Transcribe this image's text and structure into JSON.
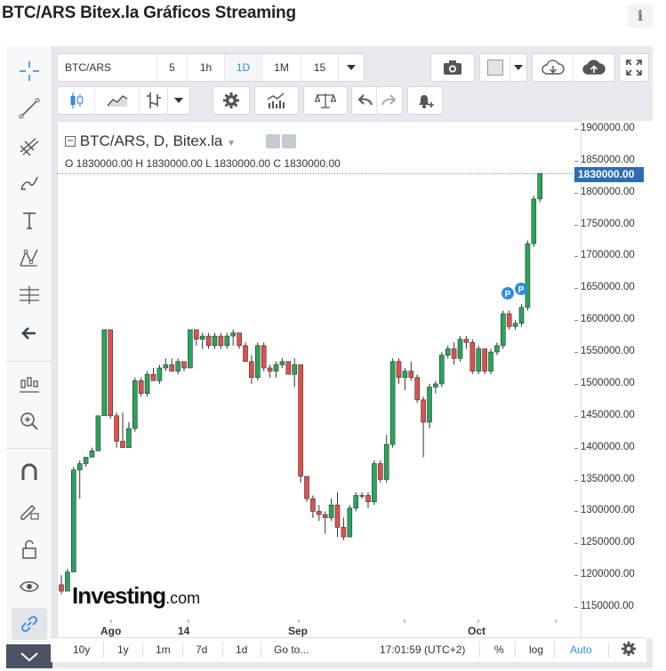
{
  "page": {
    "title": "BTC/ARS Bitex.la Gráficos Streaming",
    "info_icon": "i"
  },
  "toolbar": {
    "symbol": "BTC/ARS",
    "intervals": [
      "5",
      "1h",
      "1D",
      "1M",
      "15"
    ],
    "selected_interval": "1D",
    "row2_icons": [
      "candles-icon",
      "area-chart-icon",
      "bars-icon",
      "settings-icon",
      "indicators-icon",
      "compare-icon",
      "undo-icon",
      "redo-icon",
      "alert-icon"
    ],
    "right_icons": [
      "camera-icon",
      "color-square-icon",
      "cloud-download-icon",
      "cloud-upload-icon",
      "fullscreen-icon"
    ]
  },
  "left_tools": [
    "crosshair-icon",
    "trend-line-icon",
    "pitchfork-icon",
    "brush-icon",
    "text-icon",
    "pattern-icon",
    "measure-icon",
    "back-arrow-icon",
    "candle-zoom-icon",
    "zoom-in-icon",
    "magnet-icon",
    "lock-pencil-icon",
    "unlock-icon",
    "eye-icon",
    "link-icon"
  ],
  "legend": {
    "title": "BTC/ARS, D, Bitex.la",
    "ohlc": "O 1830000.00  H 1830000.00  L 1830000.00  C 1830000.00"
  },
  "price_axis": {
    "labels": [
      "1900000.00",
      "1850000.00",
      "1800000.00",
      "1750000.00",
      "1700000.00",
      "1650000.00",
      "1600000.00",
      "1550000.00",
      "1500000.00",
      "1450000.00",
      "1400000.00",
      "1350000.00",
      "1300000.00",
      "1250000.00",
      "1200000.00",
      "1150000.00"
    ],
    "last_price": "1830000.00"
  },
  "time_axis": {
    "labels": [
      "Ago",
      "14",
      "Sep",
      "Oct"
    ]
  },
  "bottom_bar": {
    "ranges": [
      "10y",
      "1y",
      "1m",
      "7d",
      "1d"
    ],
    "goto": "Go to...",
    "time": "17:01:59 (UTC+2)",
    "percent": "%",
    "log": "log",
    "auto": "Auto"
  },
  "watermark": {
    "brand": "Investing",
    "suffix": ".com"
  },
  "colors": {
    "up": "#26a65b",
    "down": "#e0514d",
    "accent": "#2f8de4",
    "last_price_bg": "#2d6db0"
  },
  "chart_data": {
    "type": "candlestick",
    "ylim": [
      1130000,
      1910000
    ],
    "yticks": [
      1150000,
      1200000,
      1250000,
      1300000,
      1350000,
      1400000,
      1450000,
      1500000,
      1550000,
      1600000,
      1650000,
      1700000,
      1750000,
      1800000,
      1850000,
      1900000
    ],
    "last_value": 1830000,
    "candles": [
      [
        1185000,
        1200000,
        1170000,
        1175000
      ],
      [
        1175000,
        1210000,
        1175000,
        1205000
      ],
      [
        1205000,
        1370000,
        1205000,
        1365000
      ],
      [
        1365000,
        1380000,
        1320000,
        1375000
      ],
      [
        1375000,
        1385000,
        1370000,
        1385000
      ],
      [
        1385000,
        1400000,
        1385000,
        1395000
      ],
      [
        1395000,
        1450000,
        1395000,
        1450000
      ],
      [
        1450000,
        1585000,
        1450000,
        1585000
      ],
      [
        1585000,
        1585000,
        1445000,
        1450000
      ],
      [
        1450000,
        1455000,
        1400000,
        1410000
      ],
      [
        1410000,
        1455000,
        1400000,
        1400000
      ],
      [
        1400000,
        1440000,
        1400000,
        1430000
      ],
      [
        1430000,
        1510000,
        1425000,
        1505000
      ],
      [
        1505000,
        1510000,
        1480000,
        1485000
      ],
      [
        1485000,
        1520000,
        1480000,
        1515000
      ],
      [
        1515000,
        1525000,
        1505000,
        1505000
      ],
      [
        1505000,
        1530000,
        1500000,
        1525000
      ],
      [
        1525000,
        1540000,
        1520000,
        1530000
      ],
      [
        1530000,
        1540000,
        1520000,
        1520000
      ],
      [
        1520000,
        1540000,
        1515000,
        1535000
      ],
      [
        1535000,
        1535000,
        1520000,
        1525000
      ],
      [
        1525000,
        1585000,
        1525000,
        1585000
      ],
      [
        1585000,
        1585000,
        1560000,
        1570000
      ],
      [
        1570000,
        1580000,
        1555000,
        1575000
      ],
      [
        1575000,
        1580000,
        1555000,
        1560000
      ],
      [
        1560000,
        1580000,
        1555000,
        1575000
      ],
      [
        1575000,
        1580000,
        1555000,
        1560000
      ],
      [
        1560000,
        1580000,
        1555000,
        1575000
      ],
      [
        1575000,
        1585000,
        1560000,
        1580000
      ],
      [
        1580000,
        1580000,
        1555000,
        1560000
      ],
      [
        1560000,
        1565000,
        1535000,
        1535000
      ],
      [
        1535000,
        1545000,
        1500000,
        1510000
      ],
      [
        1510000,
        1565000,
        1505000,
        1560000
      ],
      [
        1560000,
        1565000,
        1520000,
        1525000
      ],
      [
        1525000,
        1530000,
        1510000,
        1520000
      ],
      [
        1520000,
        1535000,
        1510000,
        1530000
      ],
      [
        1530000,
        1540000,
        1525000,
        1535000
      ],
      [
        1535000,
        1535000,
        1515000,
        1515000
      ],
      [
        1515000,
        1540000,
        1495000,
        1530000
      ],
      [
        1530000,
        1530000,
        1345000,
        1355000
      ],
      [
        1355000,
        1355000,
        1315000,
        1320000
      ],
      [
        1320000,
        1325000,
        1290000,
        1300000
      ],
      [
        1300000,
        1310000,
        1285000,
        1295000
      ],
      [
        1295000,
        1300000,
        1265000,
        1290000
      ],
      [
        1290000,
        1320000,
        1285000,
        1310000
      ],
      [
        1310000,
        1330000,
        1260000,
        1275000
      ],
      [
        1275000,
        1290000,
        1255000,
        1260000
      ],
      [
        1260000,
        1310000,
        1260000,
        1305000
      ],
      [
        1305000,
        1330000,
        1300000,
        1325000
      ],
      [
        1325000,
        1330000,
        1320000,
        1325000
      ],
      [
        1325000,
        1330000,
        1305000,
        1315000
      ],
      [
        1315000,
        1380000,
        1310000,
        1375000
      ],
      [
        1375000,
        1380000,
        1345000,
        1350000
      ],
      [
        1350000,
        1420000,
        1345000,
        1405000
      ],
      [
        1405000,
        1540000,
        1400000,
        1535000
      ],
      [
        1535000,
        1540000,
        1500000,
        1510000
      ],
      [
        1510000,
        1525000,
        1490000,
        1520000
      ],
      [
        1520000,
        1535000,
        1505000,
        1510000
      ],
      [
        1510000,
        1515000,
        1470000,
        1475000
      ],
      [
        1475000,
        1480000,
        1385000,
        1440000
      ],
      [
        1440000,
        1500000,
        1430000,
        1495000
      ],
      [
        1495000,
        1505000,
        1485000,
        1500000
      ],
      [
        1500000,
        1550000,
        1495000,
        1545000
      ],
      [
        1545000,
        1560000,
        1540000,
        1555000
      ],
      [
        1555000,
        1565000,
        1530000,
        1540000
      ],
      [
        1540000,
        1575000,
        1535000,
        1570000
      ],
      [
        1570000,
        1575000,
        1555000,
        1565000
      ],
      [
        1565000,
        1570000,
        1515000,
        1520000
      ],
      [
        1520000,
        1560000,
        1515000,
        1555000
      ],
      [
        1555000,
        1555000,
        1515000,
        1520000
      ],
      [
        1520000,
        1555000,
        1515000,
        1550000
      ],
      [
        1550000,
        1565000,
        1545000,
        1560000
      ],
      [
        1560000,
        1615000,
        1555000,
        1610000
      ],
      [
        1610000,
        1615000,
        1585000,
        1590000
      ],
      [
        1590000,
        1600000,
        1585000,
        1595000
      ],
      [
        1595000,
        1625000,
        1590000,
        1620000
      ],
      [
        1620000,
        1725000,
        1615000,
        1720000
      ],
      [
        1720000,
        1795000,
        1715000,
        1790000
      ],
      [
        1790000,
        1830000,
        1785000,
        1830000
      ]
    ]
  }
}
